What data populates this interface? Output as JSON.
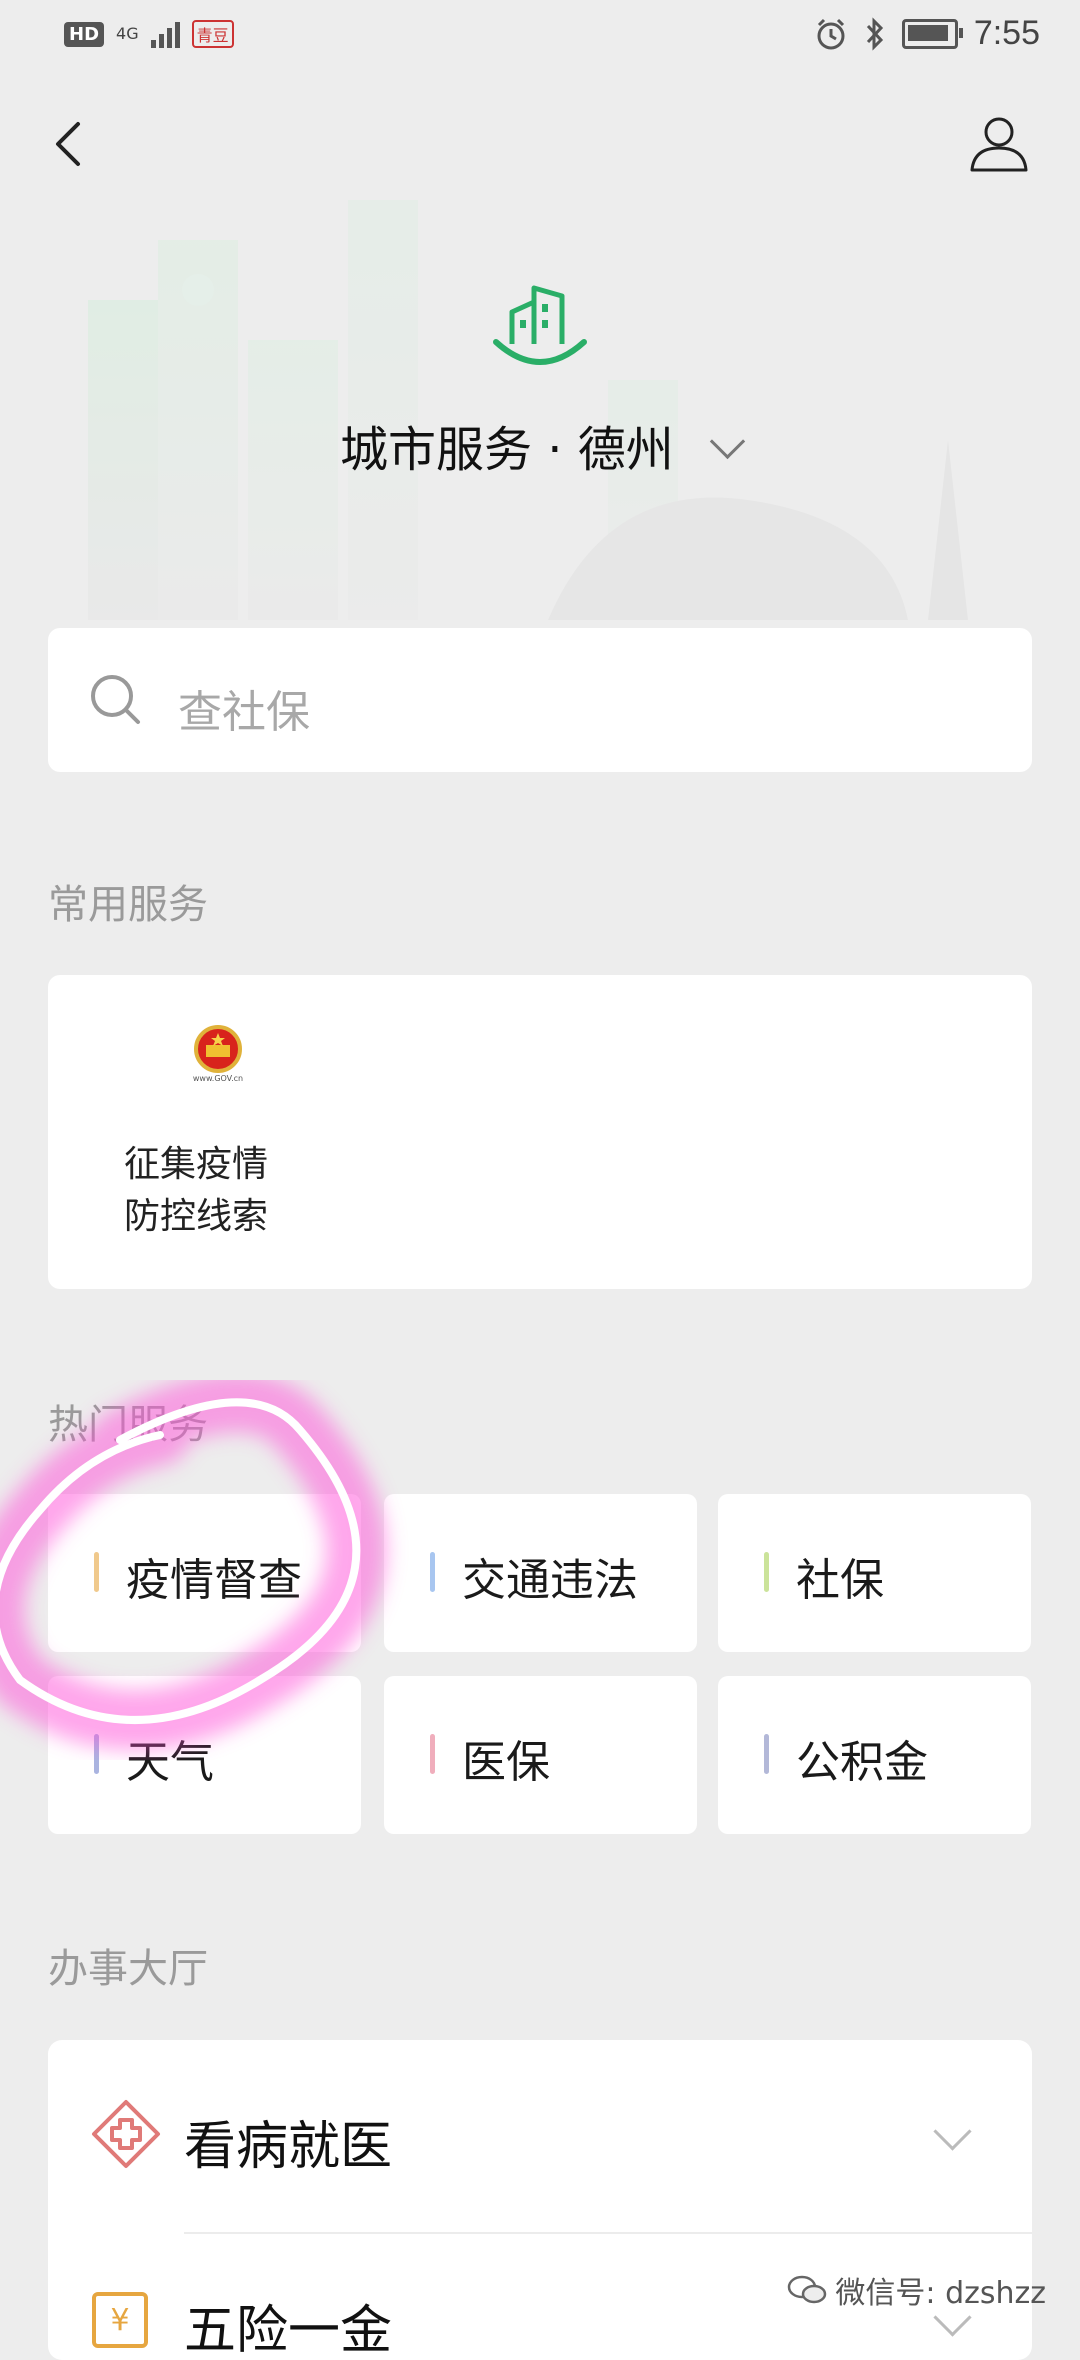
{
  "status_bar": {
    "hd": "HD",
    "network": "4G",
    "carrier_badge": "青豆",
    "time": "7:55"
  },
  "header": {
    "city_title": "城市服务 · 德州"
  },
  "search": {
    "placeholder": "查社保"
  },
  "common_services": {
    "label": "常用服务",
    "items": [
      {
        "name_line1": "征集疫情",
        "name_line2": "防控线索",
        "emblem_caption": "www.GOV.cn",
        "icon": "national-emblem-icon"
      }
    ]
  },
  "hot_services": {
    "label": "热门服务",
    "items": [
      {
        "label": "疫情督查",
        "accent": "#f0c98c"
      },
      {
        "label": "交通违法",
        "accent": "#a8c6f0"
      },
      {
        "label": "社保",
        "accent": "#cbe39a"
      },
      {
        "label": "天气",
        "accent": "#aab4e0"
      },
      {
        "label": "医保",
        "accent": "#f0aebc"
      },
      {
        "label": "公积金",
        "accent": "#b3b8d8"
      }
    ]
  },
  "office_hall": {
    "label": "办事大厅",
    "items": [
      {
        "label": "看病就医",
        "icon": "medical-cross-icon"
      },
      {
        "label": "五险一金",
        "icon": "yen-icon"
      }
    ]
  },
  "watermark": "微信号: dzshzz",
  "colors": {
    "brand_green": "#2aae67",
    "background": "#ededed",
    "highlight_pink": "#ff4fd8"
  }
}
